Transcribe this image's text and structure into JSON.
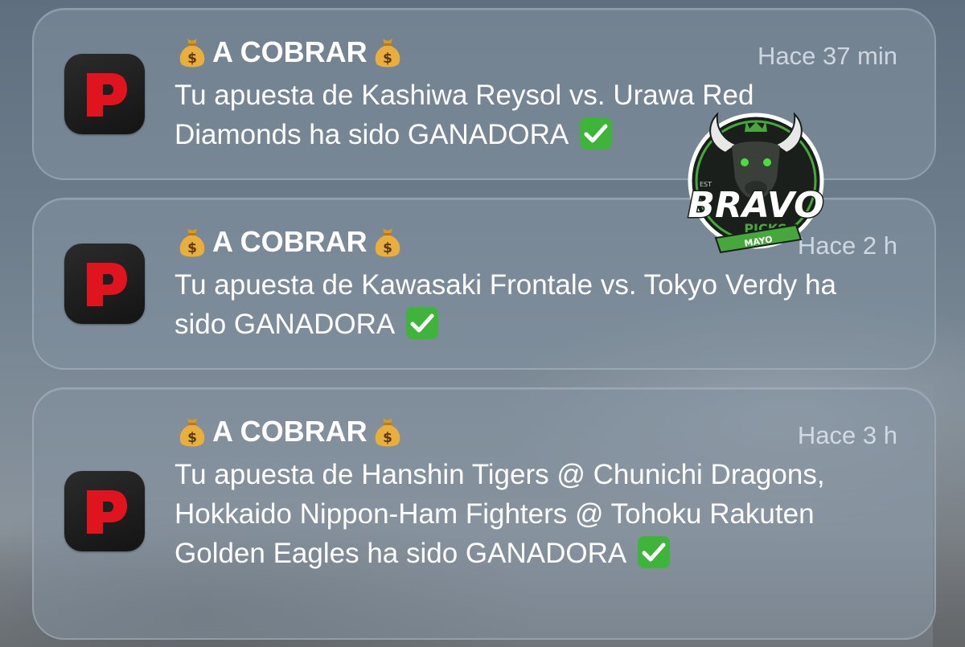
{
  "notifications": [
    {
      "app_icon": "red-p-app-icon",
      "title": "A COBRAR",
      "time": "Hace 37 min",
      "body": "Tu apuesta de Kashiwa Reysol vs. Urawa Red Diamonds ha sido GANADORA"
    },
    {
      "app_icon": "red-p-app-icon",
      "title": "A COBRAR",
      "time": "Hace 2 h",
      "body": "Tu apuesta de Kawasaki Frontale vs. Tokyo Verdy ha sido GANADORA"
    },
    {
      "app_icon": "red-p-app-icon",
      "title": "A COBRAR",
      "time": "Hace 3 h",
      "body": "Tu apuesta de Hanshin Tigers @ Chunichi Dragons, Hokkaido Nippon-Ham Fighters @ Tohoku Rakuten Golden Eagles ha sido GANADORA"
    }
  ],
  "watermark": {
    "brand": "BRAVO",
    "sub": "PICKS",
    "ribbon": "MAYO",
    "est": "EST"
  },
  "colors": {
    "app_icon_red": "#e0141e",
    "check_green": "#3fb43a",
    "watermark_green": "#46a83c"
  }
}
